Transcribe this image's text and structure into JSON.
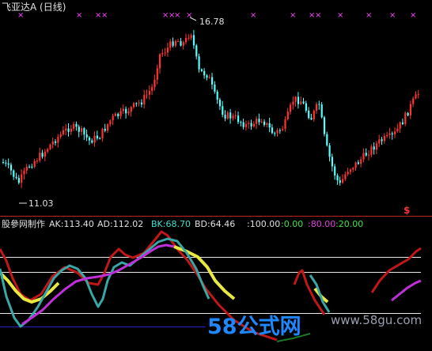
{
  "window_title": "飞亚达A (日线)",
  "colors": {
    "background": "#000000",
    "candle_up": "#ff3333",
    "candle_down": "#54ffff",
    "marker": "#ff44ff",
    "ak_line": "#c01818",
    "ad_line": "#e8e840",
    "bk_line": "#3aa7a7",
    "bd_line": "#c030d8",
    "ref_line": "#e8e8e8",
    "low_ref": "#2020c0"
  },
  "price_chart": {
    "high_annotation": "16.78",
    "low_annotation": "11.03",
    "corner_mark": "$",
    "markers_symbol": "×"
  },
  "indicator_panel": {
    "title": "股參网制作",
    "values": [
      {
        "label": "AK:",
        "value": "113.40",
        "color": "#e0e0e0"
      },
      {
        "label": "AD:",
        "value": "112.02",
        "color": "#e0e0e0"
      },
      {
        "label": "BK:",
        "value": "68.70",
        "color": "#40e0d0"
      },
      {
        "label": "BD:",
        "value": "64.46",
        "color": "#e0e0e0"
      },
      {
        "label": ":",
        "value": "100.00",
        "color": "#e0e0e0"
      },
      {
        "label": ":",
        "value": "0.00",
        "color": "#40e040"
      },
      {
        "label": ":",
        "value": "80.00",
        "color": "#e040e0"
      },
      {
        "label": ":",
        "value": "20.00",
        "color": "#40e040"
      }
    ]
  },
  "watermark": {
    "brand": "58公式网",
    "url": "www.58gu.com"
  },
  "chart_data": {
    "type": "line",
    "title": "飞亚达A (日线)",
    "price_high": 16.78,
    "price_low": 11.03,
    "indicator_levels": [
      100,
      80,
      20,
      0
    ],
    "series": [
      {
        "name": "AK",
        "last": 113.4
      },
      {
        "name": "AD",
        "last": 112.02
      },
      {
        "name": "BK",
        "last": 68.7
      },
      {
        "name": "BD",
        "last": 64.46
      }
    ]
  }
}
